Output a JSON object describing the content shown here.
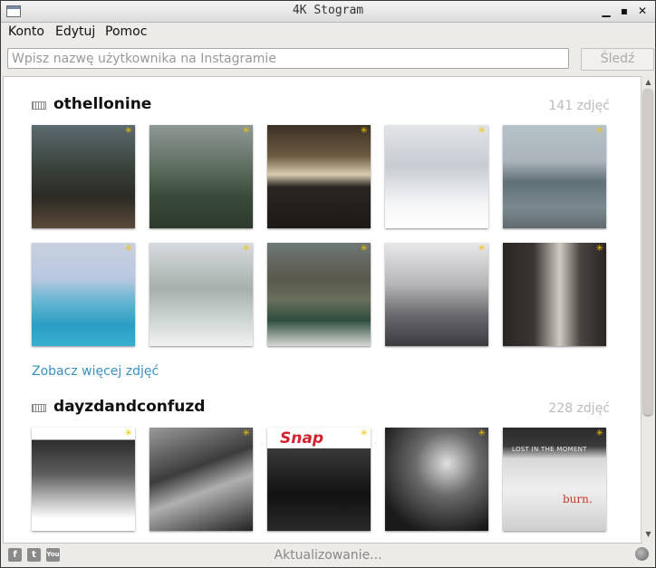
{
  "window": {
    "title": "4K Stogram"
  },
  "menu": [
    "Konto",
    "Edytuj",
    "Pomoc"
  ],
  "search": {
    "placeholder": "Wpisz nazwę użytkownika na Instagramie",
    "value": "",
    "follow_label": "Śledź"
  },
  "sections": [
    {
      "username": "othellonine",
      "count": "141 zdjęć",
      "more_link": "Zobacz więcej zdjęć",
      "photos": [
        "forest-bridge",
        "misty-forest",
        "dark-bridge-arches",
        "snowy-forest",
        "lake-rock",
        "hot-pool",
        "snowy-lake",
        "mountain-lake",
        "forest-road",
        "room-window"
      ]
    },
    {
      "username": "dayzdandconfuzd",
      "count": "228 zdjęć",
      "photos": [
        "bw-wall",
        "bw-building",
        "snap-cover",
        "bw-smoke",
        "burn-cover"
      ]
    }
  ],
  "covers": {
    "snap_logo": "Snap",
    "lost_text": "LOST IN THE MOMENT",
    "burn_text": "burn."
  },
  "status": {
    "text": "Aktualizowanie...",
    "social": [
      "facebook-icon",
      "twitter-icon",
      "youtube-icon"
    ]
  },
  "colors": {
    "link": "#3a8fc4",
    "new_star": "#f2c200"
  }
}
